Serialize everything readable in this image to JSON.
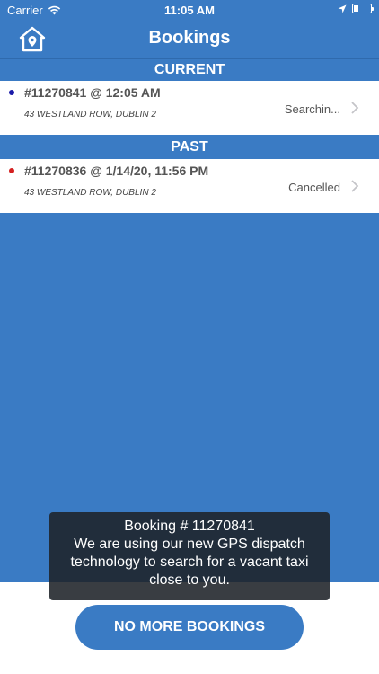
{
  "status_bar": {
    "carrier": "Carrier",
    "time": "11:05 AM"
  },
  "nav": {
    "title": "Bookings",
    "home_icon": "home-pin-icon"
  },
  "sections": {
    "current": {
      "header": "CURRENT",
      "bookings": [
        {
          "title": "#11270841 @ 12:05 AM",
          "address": "43 WESTLAND ROW, DUBLIN 2",
          "status": "Searchin...",
          "dot_color": "#1a1aa8"
        }
      ]
    },
    "past": {
      "header": "PAST",
      "bookings": [
        {
          "title": "#11270836 @ 1/14/20, 11:56 PM",
          "address": "43 WESTLAND ROW, DUBLIN 2",
          "status": "Cancelled",
          "dot_color": "#d42020"
        }
      ]
    }
  },
  "toast": {
    "line1": "Booking # 11270841",
    "line2": "We are using our new GPS dispatch",
    "line3": "technology to search for a vacant taxi",
    "line4": "close to you."
  },
  "footer": {
    "button_label": "NO MORE BOOKINGS"
  },
  "colors": {
    "primary": "#3a7bc4",
    "white": "#ffffff"
  }
}
